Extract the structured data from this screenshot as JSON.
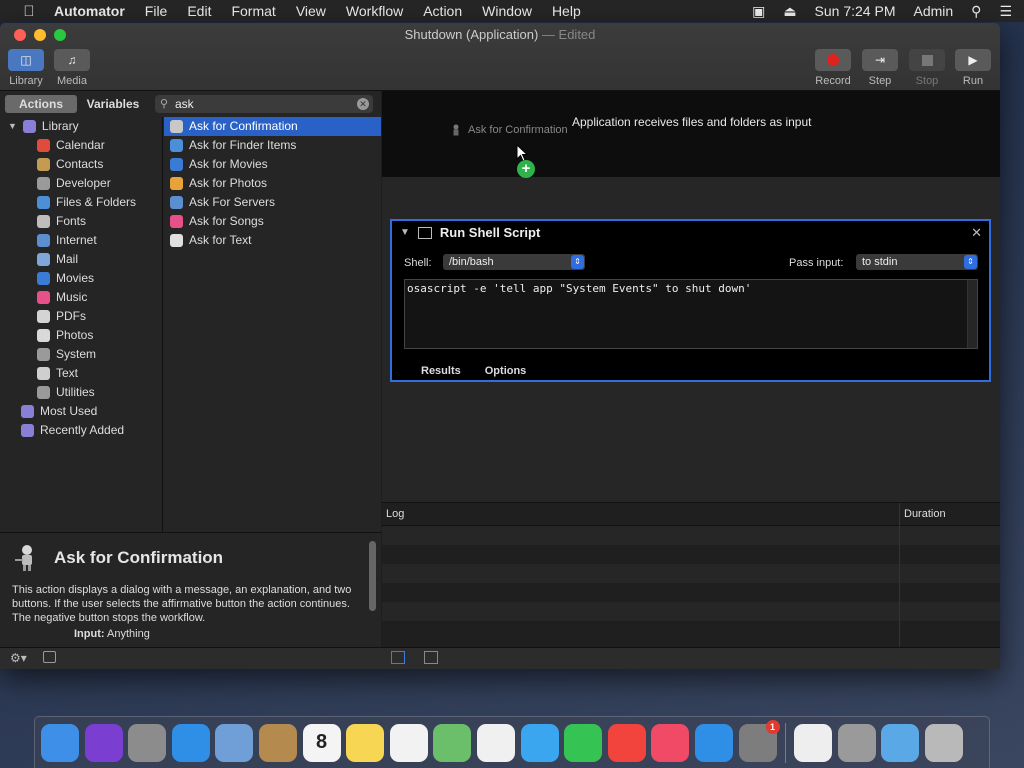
{
  "menubar": {
    "app": "Automator",
    "items": [
      "File",
      "Edit",
      "Format",
      "View",
      "Workflow",
      "Action",
      "Window",
      "Help"
    ],
    "clock": "Sun 7:24 PM",
    "user": "Admin"
  },
  "window": {
    "title": "Shutdown (Application)",
    "edited": "— Edited",
    "toolbar": {
      "library": "Library",
      "media": "Media",
      "record": "Record",
      "step": "Step",
      "stop": "Stop",
      "run": "Run"
    }
  },
  "library_pane": {
    "tabs": [
      "Actions",
      "Variables"
    ],
    "search_value": "ask",
    "categories": [
      {
        "label": "Library",
        "color": "#8a7fd6"
      },
      {
        "label": "Calendar",
        "color": "#e04b3c"
      },
      {
        "label": "Contacts",
        "color": "#c59a52"
      },
      {
        "label": "Developer",
        "color": "#9a9a9a"
      },
      {
        "label": "Files & Folders",
        "color": "#4a8fd8"
      },
      {
        "label": "Fonts",
        "color": "#bdbdbd"
      },
      {
        "label": "Internet",
        "color": "#5b8fcf"
      },
      {
        "label": "Mail",
        "color": "#7ea6d9"
      },
      {
        "label": "Movies",
        "color": "#3a7bd5"
      },
      {
        "label": "Music",
        "color": "#e8508a"
      },
      {
        "label": "PDFs",
        "color": "#d4d4d4"
      },
      {
        "label": "Photos",
        "color": "#d9d9d9"
      },
      {
        "label": "System",
        "color": "#9a9a9a"
      },
      {
        "label": "Text",
        "color": "#cfcfcf"
      },
      {
        "label": "Utilities",
        "color": "#9a9a9a"
      },
      {
        "label": "Most Used",
        "color": "#8a7fd6"
      },
      {
        "label": "Recently Added",
        "color": "#8a7fd6"
      }
    ],
    "actions": [
      {
        "label": "Ask for Confirmation",
        "color": "#c8c8c8"
      },
      {
        "label": "Ask for Finder Items",
        "color": "#4a8fd8"
      },
      {
        "label": "Ask for Movies",
        "color": "#3a7bd5"
      },
      {
        "label": "Ask for Photos",
        "color": "#e8a23a"
      },
      {
        "label": "Ask For Servers",
        "color": "#5b8fcf"
      },
      {
        "label": "Ask for Songs",
        "color": "#e8508a"
      },
      {
        "label": "Ask for Text",
        "color": "#e0e0e0"
      }
    ],
    "description": {
      "title": "Ask for Confirmation",
      "body": "This action displays a dialog with a message, an explanation, and two buttons. If the user selects the affirmative button the action continues. The negative button stops the workflow.",
      "input_label": "Input:",
      "input_value": "Anything"
    }
  },
  "workflow": {
    "input_message": "Application receives files and folders as input",
    "drag_ghost": "Ask for Confirmation",
    "action": {
      "title": "Run Shell Script",
      "shell_label": "Shell:",
      "shell_value": "/bin/bash",
      "pass_label": "Pass input:",
      "pass_value": "to stdin",
      "script": "osascript -e 'tell app \"System Events\" to shut down'",
      "tabs": [
        "Results",
        "Options"
      ]
    },
    "log": {
      "col1": "Log",
      "col2": "Duration"
    }
  },
  "dock": {
    "calendar_day": "8",
    "badge": "1",
    "items": [
      {
        "name": "finder-icon",
        "color": "#3d8fe8"
      },
      {
        "name": "siri-icon",
        "color": "#7a3fd0"
      },
      {
        "name": "launchpad-icon",
        "color": "#8c8c8c"
      },
      {
        "name": "safari-icon",
        "color": "#2f8ee6"
      },
      {
        "name": "mail-stamp-icon",
        "color": "#6f9fd6"
      },
      {
        "name": "contacts-icon",
        "color": "#b58a4f"
      },
      {
        "name": "calendar-icon",
        "color": "#f4f4f4"
      },
      {
        "name": "notes-icon",
        "color": "#f7d654"
      },
      {
        "name": "reminders-icon",
        "color": "#f2f2f2"
      },
      {
        "name": "maps-icon",
        "color": "#6cbf6a"
      },
      {
        "name": "photos-icon",
        "color": "#f0f0f0"
      },
      {
        "name": "messages-icon",
        "color": "#3aa6f0"
      },
      {
        "name": "facetime-icon",
        "color": "#35c353"
      },
      {
        "name": "news-icon",
        "color": "#f2433c"
      },
      {
        "name": "music-icon",
        "color": "#f04a67"
      },
      {
        "name": "app-store-icon",
        "color": "#2f8ee6"
      },
      {
        "name": "system-preferences-icon",
        "color": "#7d7d7d"
      },
      {
        "name": "textedit-icon",
        "color": "#eeeeee"
      },
      {
        "name": "automator-icon",
        "color": "#9a9a9a"
      },
      {
        "name": "downloads-folder-icon",
        "color": "#5aa9e6"
      },
      {
        "name": "trash-icon",
        "color": "#b9b9b9"
      }
    ]
  }
}
